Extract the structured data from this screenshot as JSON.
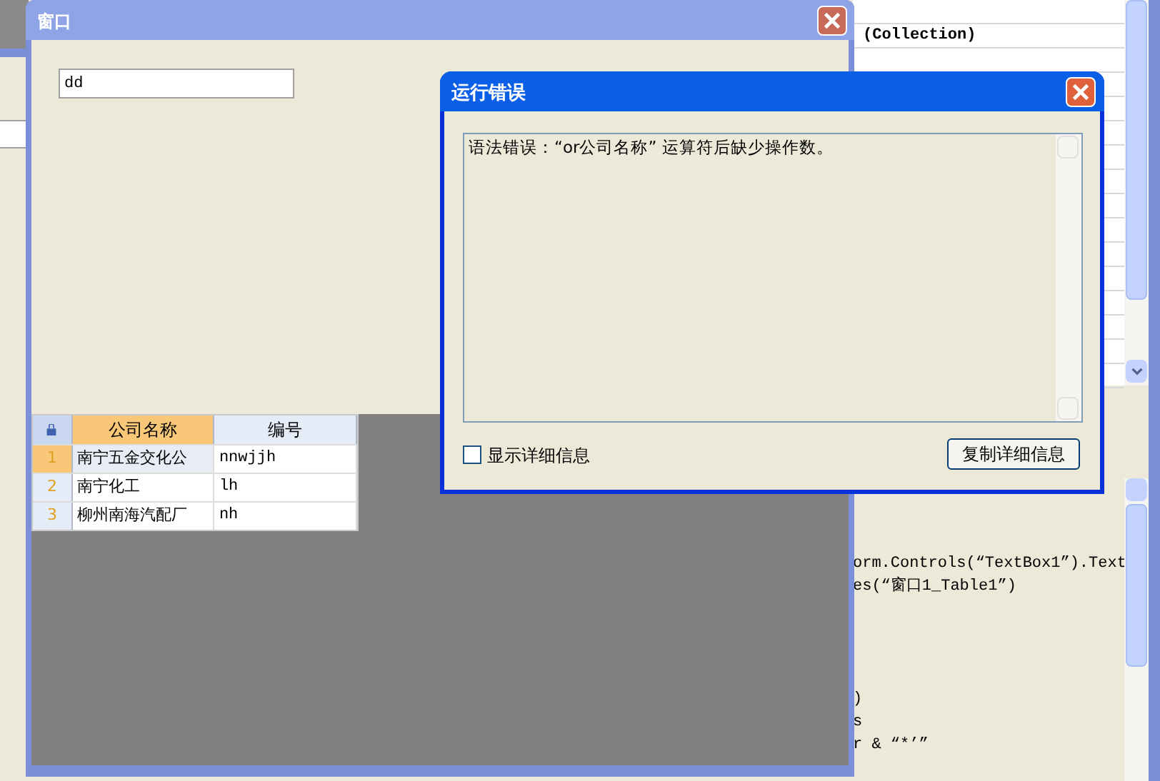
{
  "property_grid": {
    "value": "(Collection)"
  },
  "code_editor": {
    "blocks": [
      [
        "orm.Controls(“TextBox1”).Text",
        "es(“窗口1_Table1”)"
      ],
      [
        ")",
        "s",
        "r & “*’”"
      ]
    ]
  },
  "main_window": {
    "title": "窗口",
    "text_field": {
      "value": "dd"
    },
    "grid": {
      "columns": [
        {
          "label": "公司名称",
          "selected": true
        },
        {
          "label": "编号",
          "selected": false
        }
      ],
      "rows": [
        {
          "number": "1",
          "selected": true,
          "cells": [
            "南宁五金交化公",
            "nnwjjh"
          ]
        },
        {
          "number": "2",
          "selected": false,
          "cells": [
            "南宁化工",
            "lh"
          ]
        },
        {
          "number": "3",
          "selected": false,
          "cells": [
            "柳州南海汽配厂",
            "nh"
          ]
        }
      ]
    }
  },
  "error_dialog": {
    "title": "运行错误",
    "message": "语法错误：“or公司名称” 运算符后缺少操作数。",
    "checkbox": {
      "label": "显示详细信息",
      "checked": false
    },
    "button": "复制详细信息"
  }
}
